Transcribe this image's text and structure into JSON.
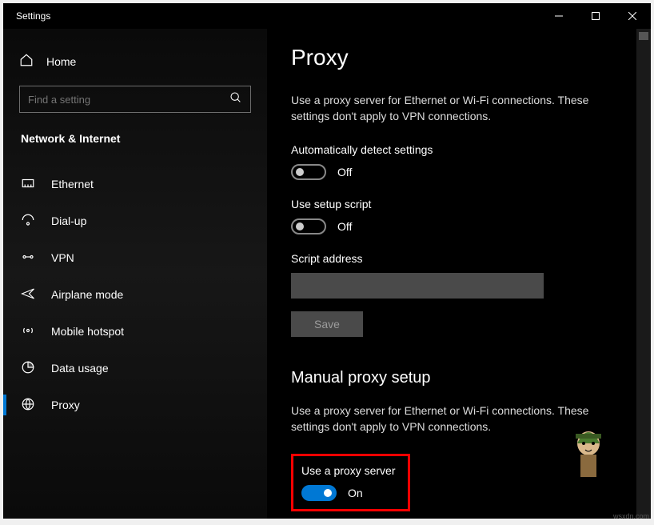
{
  "window": {
    "title": "Settings"
  },
  "sidebar": {
    "home": "Home",
    "search_placeholder": "Find a setting",
    "category": "Network & Internet",
    "items": [
      {
        "label": "Ethernet"
      },
      {
        "label": "Dial-up"
      },
      {
        "label": "VPN"
      },
      {
        "label": "Airplane mode"
      },
      {
        "label": "Mobile hotspot"
      },
      {
        "label": "Data usage"
      },
      {
        "label": "Proxy"
      }
    ]
  },
  "main": {
    "page_title": "Proxy",
    "intro": "Use a proxy server for Ethernet or Wi-Fi connections. These settings don't apply to VPN connections.",
    "auto_detect_label": "Automatically detect settings",
    "auto_detect_state": "Off",
    "use_script_label": "Use setup script",
    "use_script_state": "Off",
    "script_address_label": "Script address",
    "script_address_value": "",
    "save_button": "Save",
    "manual_heading": "Manual proxy setup",
    "manual_intro": "Use a proxy server for Ethernet or Wi-Fi connections. These settings don't apply to VPN connections.",
    "use_proxy_label": "Use a proxy server",
    "use_proxy_state": "On"
  },
  "watermark": "wsxdn.com"
}
